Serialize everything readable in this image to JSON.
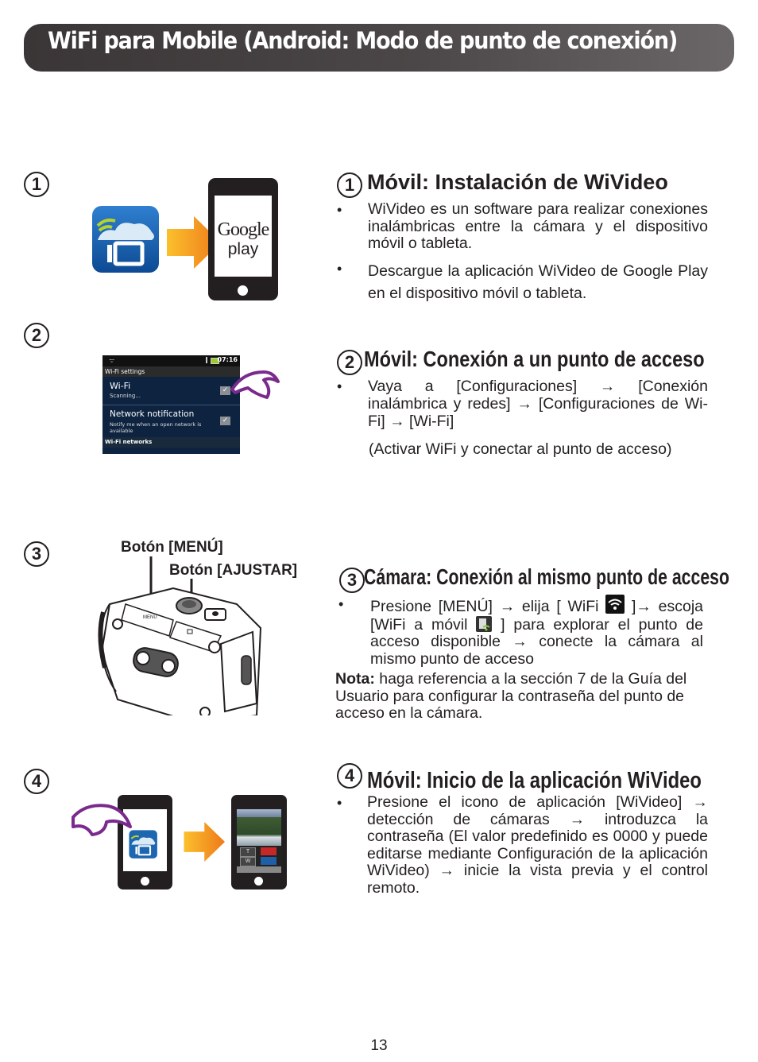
{
  "page": {
    "title": "WiFi para Mobile (Android: Modo de punto de conexión)",
    "page_number": "13"
  },
  "steps": [
    {
      "number": "1",
      "title": "Móvil: Instalación de WiVideo",
      "bullets": [
        "WiVideo es un software para realizar conexiones inalámbricas entre la cámara y el dispositivo móvil o tableta.",
        "Descargue la aplicación WiVideo de Google Play en el dispositivo móvil o tableta."
      ],
      "illustration": {
        "app_icon": "wivideo-app-icon",
        "arrow": "orange-arrow-right",
        "phone_screen_text": [
          "Google",
          "play"
        ]
      }
    },
    {
      "number": "2",
      "title": "Móvil: Conexión a un punto de acceso",
      "bullets": [
        "Vaya a [Configuraciones] → [Conexión inalámbrica y redes] → [Configuraciones de Wi-Fi] → [Wi-Fi]"
      ],
      "note": "(Activar WiFi y conectar al punto de acceso)",
      "screenshot": {
        "status_time": "07:16",
        "header": "Wi-Fi settings",
        "wifi_title": "Wi-Fi",
        "wifi_status": "Scanning...",
        "wifi_checked": true,
        "notif_title": "Network notification",
        "notif_desc": "Notify me when an open network is available",
        "notif_checked": true,
        "networks_header": "Wi-Fi networks"
      }
    },
    {
      "number": "3",
      "title": "Cámara: Conexión al mismo punto de acceso",
      "bullet_parts": {
        "a": "Presione [MENÚ] → elija [ WiFi ",
        "b": " ]→ escoja [WiFi a móvil ",
        "c": " ] para explorar el punto de acceso disponible → conecte la cámara al mismo punto de acceso"
      },
      "note_label": "Nota:",
      "note_text": " haga referencia a la sección 7 de la Guía del Usuario para configurar la contraseña del punto de acceso en la cámara.",
      "labels": {
        "menu_button": "Botón [MENÚ]",
        "set_button": "Botón [AJUSTAR]",
        "camera_menu_text": "MENU"
      }
    },
    {
      "number": "4",
      "title": "Móvil: Inicio de la aplicación WiVideo",
      "bullets": [
        "Presione el icono de aplicación [WiVideo] → detección de cámaras → introduzca la contraseña (El valor predefinido es 0000 y puede editarse mediante Configuración de la aplicación WiVideo) → inicie la vista previa y el control remoto."
      ],
      "app_screen": {
        "zoom_tele": "T",
        "zoom_wide": "W"
      }
    }
  ],
  "colors": {
    "title_bar": "#4b4647",
    "arrow_orange": "#f39a1e",
    "app_icon_blue": "#1d66b0",
    "hand_purple": "#7a2a8c",
    "android_bg": "#0d2340"
  }
}
